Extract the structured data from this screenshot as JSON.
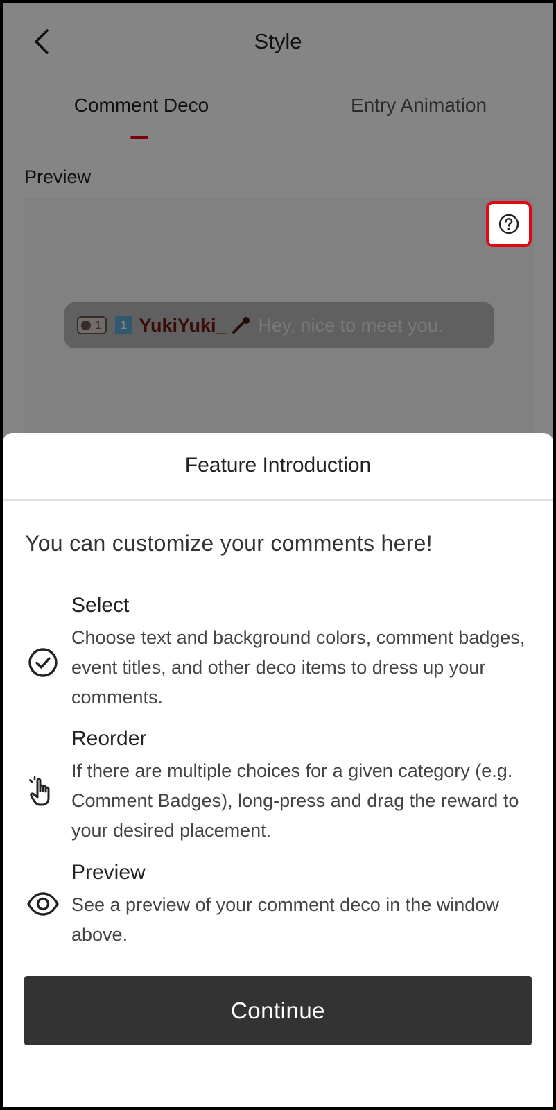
{
  "header": {
    "title": "Style"
  },
  "tabs": [
    {
      "label": "Comment Deco",
      "active": true
    },
    {
      "label": "Entry Animation",
      "active": false
    }
  ],
  "preview": {
    "label": "Preview",
    "help_icon": "question-circle-icon",
    "comment": {
      "level": "1",
      "rank": "1",
      "username": "YukiYuki_",
      "username_icon": "microphone-icon",
      "message": "Hey, nice to meet you."
    }
  },
  "sheet": {
    "title": "Feature Introduction",
    "intro": "You can customize your comments here!",
    "features": [
      {
        "icon": "check-circle-icon",
        "title": "Select",
        "description": "Choose text and background colors, comment badges, event titles, and other deco items to dress up your comments."
      },
      {
        "icon": "pointing-hand-icon",
        "title": "Reorder",
        "description": "If there are multiple choices for a given category (e.g. Comment Badges), long-press and drag the reward to your desired placement."
      },
      {
        "icon": "eye-icon",
        "title": "Preview",
        "description": "See a preview of your comment deco in the window above."
      }
    ],
    "continue_label": "Continue"
  },
  "colors": {
    "accent": "#e60012",
    "highlight_border": "#e30613",
    "button": "#333333"
  }
}
